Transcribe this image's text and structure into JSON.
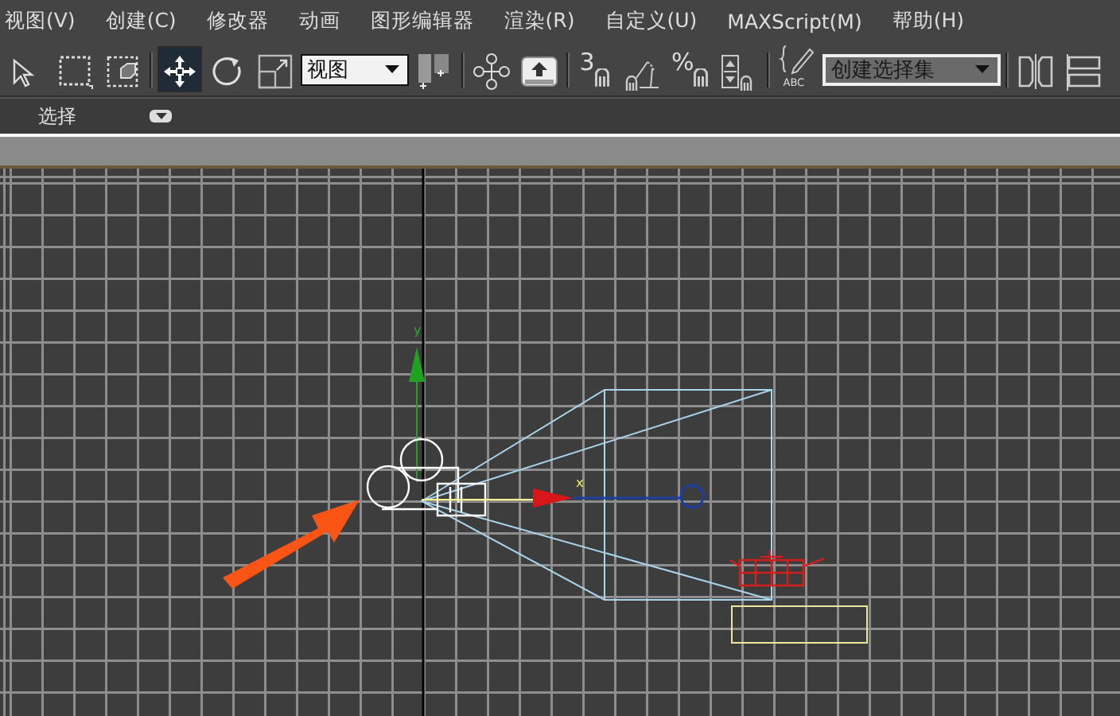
{
  "menu_bar": {
    "items": [
      {
        "label": "视图(V)"
      },
      {
        "label": "创建(C)"
      },
      {
        "label": "修改器"
      },
      {
        "label": "动画"
      },
      {
        "label": "图形编辑器"
      },
      {
        "label": "渲染(R)"
      },
      {
        "label": "自定义(U)"
      },
      {
        "label": "MAXScript(M)"
      },
      {
        "label": "帮助(H)"
      }
    ]
  },
  "toolbar": {
    "groups": [
      [
        {
          "kind": "select",
          "selected": false
        },
        {
          "kind": "region",
          "selected": false
        },
        {
          "kind": "window",
          "selected": false
        }
      ],
      [
        {
          "kind": "move",
          "selected": true
        },
        {
          "kind": "rotate",
          "selected": false
        },
        {
          "kind": "scale",
          "selected": false
        },
        {
          "kind": "dropdown",
          "value": "视图"
        },
        {
          "kind": "pivot",
          "selected": false
        }
      ],
      [
        {
          "kind": "link",
          "selected": false
        },
        {
          "kind": "bind",
          "selected": false
        }
      ],
      [
        {
          "kind": "snap",
          "glyph": "3",
          "selected": false
        },
        {
          "kind": "angle",
          "selected": false
        },
        {
          "kind": "percent",
          "glyph": "%",
          "selected": false
        },
        {
          "kind": "spinner",
          "selected": false
        }
      ],
      [
        {
          "kind": "named",
          "glyph": "ABC",
          "selected": false
        },
        {
          "kind": "combo",
          "value": "创建选择集"
        }
      ],
      [
        {
          "kind": "mirror",
          "selected": false
        },
        {
          "kind": "align",
          "selected": false
        }
      ]
    ]
  },
  "ribbon": {
    "label": "选择"
  },
  "viewport": {
    "axis_labels": [
      {
        "kind": "y",
        "label": "y"
      },
      {
        "kind": "x",
        "label": "x"
      }
    ]
  }
}
